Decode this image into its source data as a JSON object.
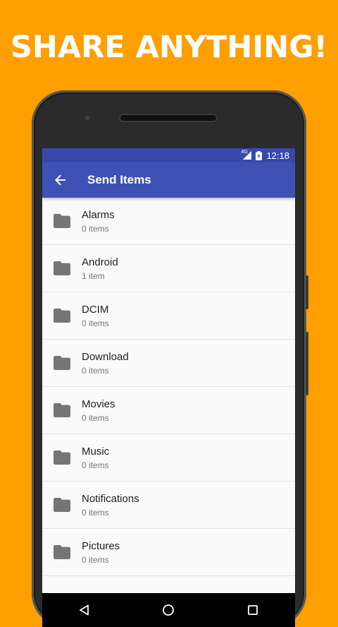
{
  "promo": {
    "headline": "SHARE ANYTHING!"
  },
  "status": {
    "network": "4G",
    "time": "12:18"
  },
  "appbar": {
    "title": "Send Items"
  },
  "items": [
    {
      "name": "Alarms",
      "count": "0 items"
    },
    {
      "name": "Android",
      "count": "1 item"
    },
    {
      "name": "DCIM",
      "count": "0 items"
    },
    {
      "name": "Download",
      "count": "0 items"
    },
    {
      "name": "Movies",
      "count": "0 items"
    },
    {
      "name": "Music",
      "count": "0 items"
    },
    {
      "name": "Notifications",
      "count": "0 items"
    },
    {
      "name": "Pictures",
      "count": "0 items"
    }
  ],
  "icons": {
    "back": "arrow-back-icon",
    "folder": "folder-icon",
    "nav": [
      "back-triangle-icon",
      "home-circle-icon",
      "recents-square-icon"
    ]
  },
  "colors": {
    "background": "#FF9F00",
    "primary": "#3F51B5",
    "primary_dark": "#3949AB",
    "folder": "#757575"
  }
}
